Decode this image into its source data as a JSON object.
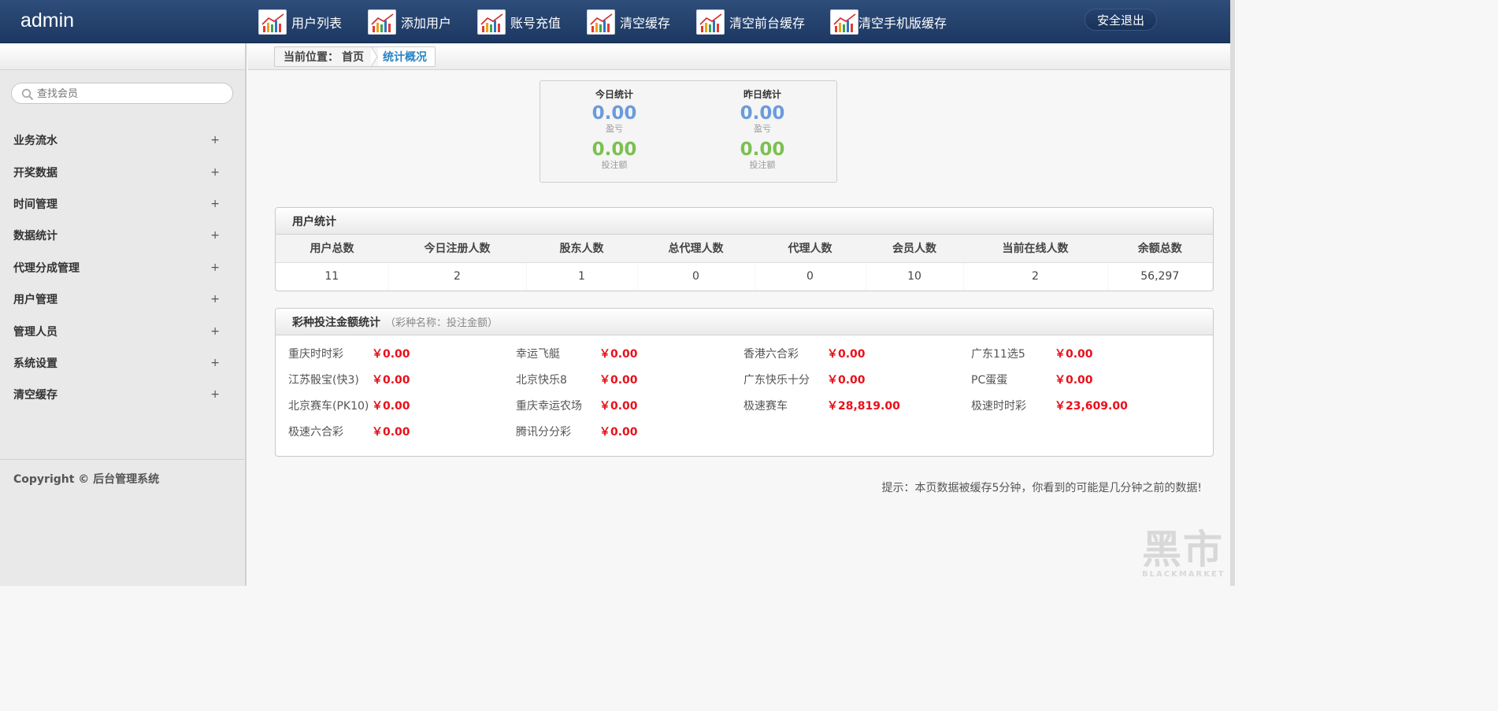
{
  "header": {
    "brand": "admin",
    "nav": [
      {
        "label": "用户列表",
        "icon": "chart-icon"
      },
      {
        "label": "添加用户",
        "icon": "chart-icon"
      },
      {
        "label": "账号充值",
        "icon": "chart-icon"
      },
      {
        "label": "清空缓存",
        "icon": "chart-icon"
      },
      {
        "label": "清空前台缓存",
        "icon": "chart-icon"
      },
      {
        "label": "清空手机版缓存",
        "icon": "chart-icon"
      }
    ],
    "logout_label": "安全退出"
  },
  "sidebar": {
    "search_placeholder": "查找会员",
    "items": [
      {
        "label": "业务流水",
        "expander": "+"
      },
      {
        "label": "开奖数据",
        "expander": "+"
      },
      {
        "label": "时间管理",
        "expander": "+"
      },
      {
        "label": "数据统计",
        "expander": "+"
      },
      {
        "label": "代理分成管理",
        "expander": "+"
      },
      {
        "label": "用户管理",
        "expander": "+"
      },
      {
        "label": "管理人员",
        "expander": "+"
      },
      {
        "label": "系统设置",
        "expander": "+"
      },
      {
        "label": "清空缓存",
        "expander": "+"
      }
    ],
    "copyright": "Copyright © 后台管理系统"
  },
  "breadcrumb": {
    "label": "当前位置：",
    "home": "首页",
    "current": "统计概况"
  },
  "daily_stats": {
    "today": {
      "title": "今日统计",
      "profit": "0.00",
      "profit_label": "盈亏",
      "bet": "0.00",
      "bet_label": "投注额"
    },
    "yesterday": {
      "title": "昨日统计",
      "profit": "0.00",
      "profit_label": "盈亏",
      "bet": "0.00",
      "bet_label": "投注额"
    }
  },
  "user_stats": {
    "title": "用户统计",
    "headers": [
      "用户总数",
      "今日注册人数",
      "股东人数",
      "总代理人数",
      "代理人数",
      "会员人数",
      "当前在线人数",
      "余额总数"
    ],
    "values": [
      "11",
      "2",
      "1",
      "0",
      "0",
      "10",
      "2",
      "56,297"
    ]
  },
  "lottery_stats": {
    "title": "彩种投注金额统计",
    "hint": "（彩种名称：投注金额）",
    "items": [
      {
        "name": "重庆时时彩",
        "amount": "￥0.00"
      },
      {
        "name": "幸运飞艇",
        "amount": "￥0.00"
      },
      {
        "name": "香港六合彩",
        "amount": "￥0.00"
      },
      {
        "name": "广东11选5",
        "amount": "￥0.00"
      },
      {
        "name": "江苏骰宝(快3)",
        "amount": "￥0.00"
      },
      {
        "name": "北京快乐8",
        "amount": "￥0.00"
      },
      {
        "name": "广东快乐十分",
        "amount": "￥0.00"
      },
      {
        "name": "PC蛋蛋",
        "amount": "￥0.00"
      },
      {
        "name": "北京赛车(PK10)",
        "amount": "￥0.00"
      },
      {
        "name": "重庆幸运农场",
        "amount": "￥0.00"
      },
      {
        "name": "极速赛车",
        "amount": "￥28,819.00"
      },
      {
        "name": "极速时时彩",
        "amount": "￥23,609.00"
      },
      {
        "name": "极速六合彩",
        "amount": "￥0.00"
      },
      {
        "name": "腾讯分分彩",
        "amount": "￥0.00"
      }
    ]
  },
  "notice": "提示：本页数据被缓存5分钟，你看到的可能是几分钟之前的数据!",
  "watermark": {
    "big": "黑市",
    "small": "BLACKMARKET"
  },
  "colors": {
    "header": "#1c3862",
    "accent_blue": "#2a83c3",
    "profit_blue": "#6b9bdc",
    "bet_green": "#7cc051",
    "amount_red": "#e8101a"
  }
}
